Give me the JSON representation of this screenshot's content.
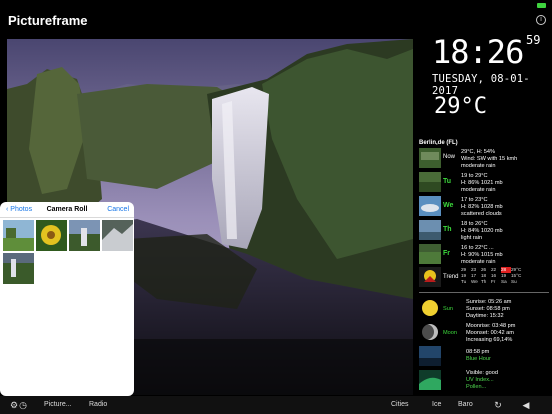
{
  "app": {
    "title": "Pictureframe"
  },
  "clock": {
    "time": "18:26",
    "seconds": "59",
    "date": "TUESDAY, 08-01-2017",
    "temp": "29°C"
  },
  "weather": {
    "location": "Berlin,de (FL)",
    "forecast": [
      {
        "day": "Now",
        "lines": [
          "29°C, H: 54%",
          "Wind: SW with 15 kmh",
          "moderate rain"
        ]
      },
      {
        "day": "Tu",
        "lines": [
          "19 to 29°C",
          "H: 86% 1021 mb",
          "moderate rain"
        ]
      },
      {
        "day": "We",
        "lines": [
          "17 to 23°C",
          "H: 82% 1028 mb",
          "scattered clouds"
        ]
      },
      {
        "day": "Th",
        "lines": [
          "18 to 26°C",
          "H: 84% 1020 mb",
          "light rain"
        ]
      },
      {
        "day": "Fr",
        "lines": [
          "16 to 22°C ...",
          "H: 90% 1015 mb",
          "moderate rain"
        ]
      }
    ],
    "trend": {
      "label": "Trend",
      "high": [
        "29",
        "23",
        "26",
        "22",
        "28",
        "29°C"
      ],
      "low": [
        "19",
        "17",
        "18",
        "16",
        "19",
        "15°C"
      ],
      "days": [
        "Tu",
        "We",
        "Th",
        "Fr",
        "Sa",
        "Su"
      ],
      "highlight_index": 4
    },
    "astro": [
      {
        "label": "Sun",
        "lines": [
          "Sunrise: 05:26 am",
          "Sunset: 08:58 pm",
          "Daytime: 15:32"
        ]
      },
      {
        "label": "Moon",
        "lines": [
          "Moonrise: 03:48 pm",
          "Moonset: 00:42 am",
          "Increasing 69,14%"
        ]
      },
      {
        "label": "",
        "lines": [
          "08:58 pm",
          "Blue Hour"
        ]
      },
      {
        "label": "",
        "lines": [
          "Visible: good",
          "UV Index...",
          "Pollen..."
        ]
      }
    ]
  },
  "picker": {
    "back": "Photos",
    "title": "Camera Roll",
    "cancel": "Cancel"
  },
  "bottombar": {
    "left_icon": "settings-gear-icon",
    "picture": "Picture...",
    "radio": "Radio",
    "cities": "Cities",
    "ice": "Ice",
    "baro": "Baro",
    "refresh_icon": "refresh-icon",
    "back_icon": "triangle-left-icon"
  },
  "colors": {
    "accent_green": "#3cd93c",
    "link_blue": "#1676e8",
    "trend_highlight": "#e02020"
  }
}
